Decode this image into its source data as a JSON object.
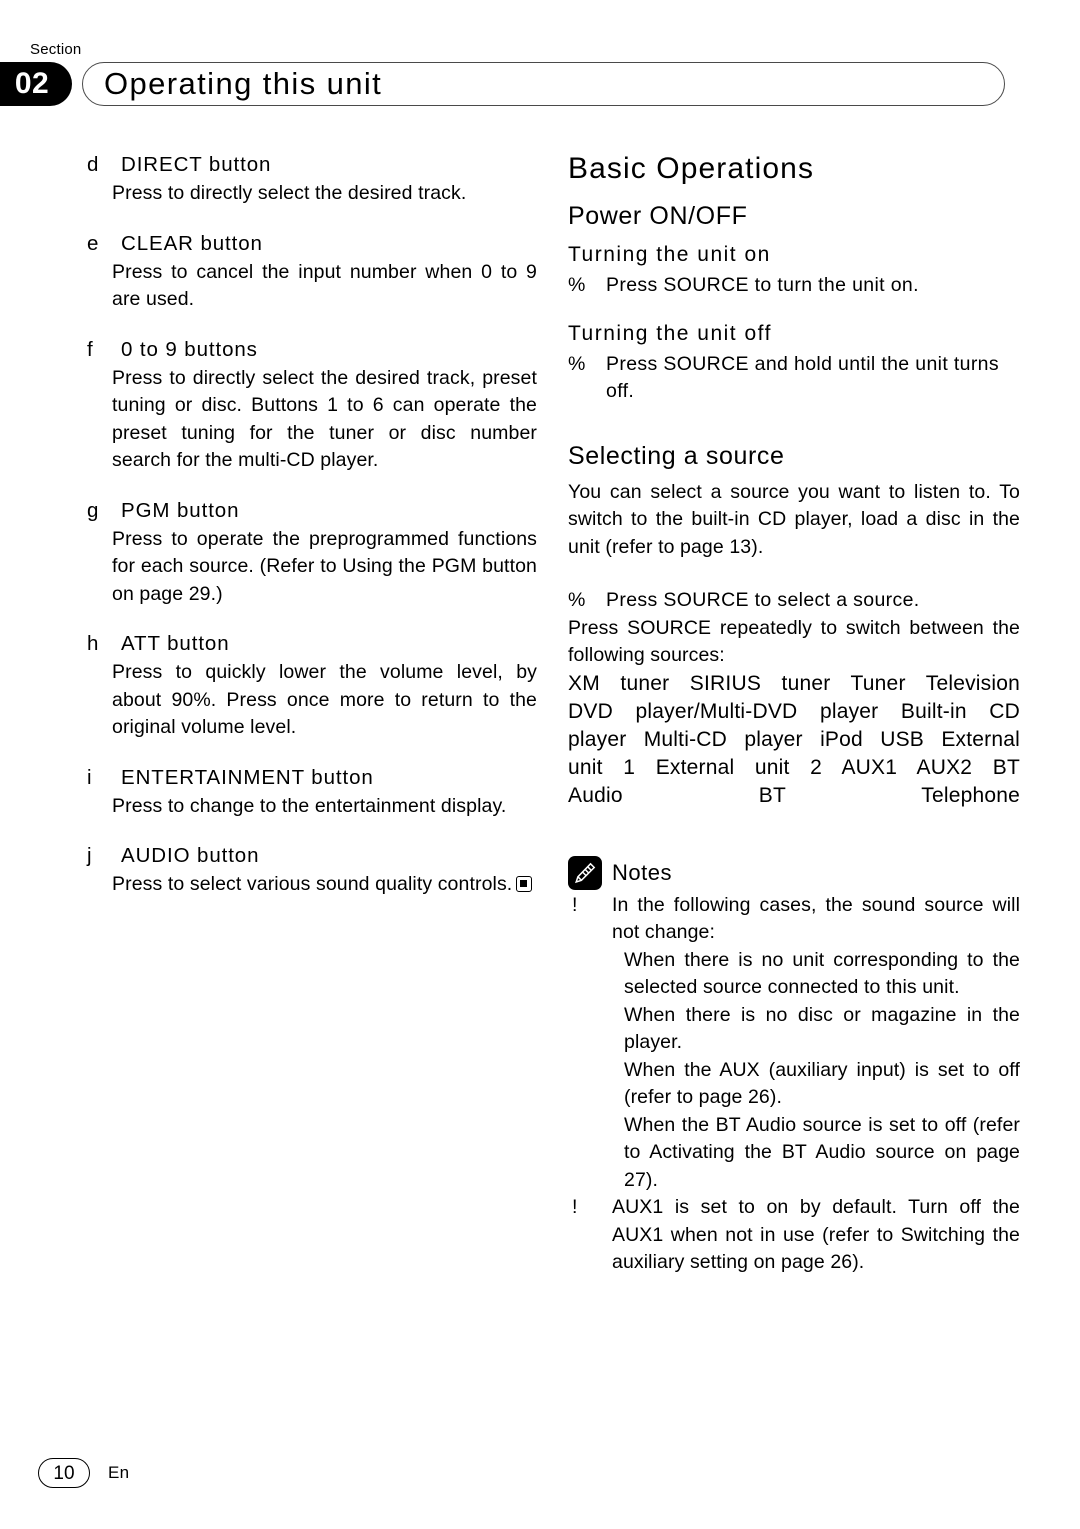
{
  "header": {
    "section_label": "Section",
    "section_number": "02",
    "title": "Operating this unit"
  },
  "left_column": {
    "items": [
      {
        "marker": "d",
        "label": "DIRECT button",
        "body": "Press to directly select the desired track."
      },
      {
        "marker": "e",
        "label": "CLEAR button",
        "body": "Press to cancel the input number when 0 to 9 are used."
      },
      {
        "marker": "f",
        "label": "0 to 9 buttons",
        "body": "Press to directly select the desired track, preset tuning or disc. Buttons 1 to 6 can operate the preset tuning for the tuner or disc number search for the multi-CD player."
      },
      {
        "marker": "g",
        "label": "PGM button",
        "body": "Press to operate the preprogrammed functions for each source. (Refer to Using the PGM button on page 29.)"
      },
      {
        "marker": "h",
        "label": "ATT button",
        "body": "Press to quickly lower the volume level, by about 90%. Press once more to return to the original volume level."
      },
      {
        "marker": "i",
        "label": "ENTERTAINMENT button",
        "body": "Press to change to the entertainment display."
      },
      {
        "marker": "j",
        "label": "AUDIO button",
        "body": "Press to select various sound quality controls."
      }
    ],
    "end_marker_icon": "end-of-section-square-icon"
  },
  "right_column": {
    "heading_basic_operations": "Basic Operations",
    "heading_power": "Power ON/OFF",
    "sub_turn_on": "Turning the unit on",
    "instr_turn_on_bullet": "%",
    "instr_turn_on": "Press SOURCE to turn the unit on.",
    "sub_turn_off": "Turning the unit off",
    "instr_turn_off_bullet": "%",
    "instr_turn_off": "Press SOURCE and hold until the unit turns off.",
    "heading_selecting_source": "Selecting a source",
    "para_selecting": "You can select a source you want to listen to. To switch to the built-in CD player, load a disc in the unit (refer to page 13).",
    "instr_select_bullet": "%",
    "instr_select": "Press SOURCE to select a source.",
    "instr_select_cont": "Press SOURCE repeatedly to switch between the following sources:",
    "sources": "XM tuner   SIRIUS tuner   Tuner   Television   DVD player/Multi-DVD player   Built-in CD player   Multi-CD player   iPod   USB   External unit 1   External unit 2   AUX1   AUX2   BT Audio   BT Telephone",
    "sources_list": [
      "XM tuner",
      "SIRIUS tuner",
      "Tuner",
      "Television",
      "DVD player/Multi-DVD player",
      "Built-in CD player",
      "Multi-CD player",
      "iPod",
      "USB",
      "External unit 1",
      "External unit 2",
      "AUX1",
      "AUX2",
      "BT Audio",
      "BT Telephone"
    ],
    "notes": {
      "icon": "pencil-icon",
      "label": "Notes",
      "bullet": "!",
      "items": [
        {
          "text": "In the following cases, the sound source will not change:",
          "sub_items": [
            "When there is no unit corresponding to the selected source connected to this unit.",
            "When there is no disc or magazine in the player.",
            "When the AUX (auxiliary input) is set to off (refer to page 26).",
            "When the BT Audio source is set to off (refer to Activating the BT Audio source on page 27)."
          ]
        },
        {
          "text": "AUX1 is set to on by default. Turn off the AUX1 when not in use (refer to Switching the auxiliary setting on page 26).",
          "sub_items": []
        }
      ]
    }
  },
  "footer": {
    "page_number": "10",
    "language_code": "En"
  }
}
